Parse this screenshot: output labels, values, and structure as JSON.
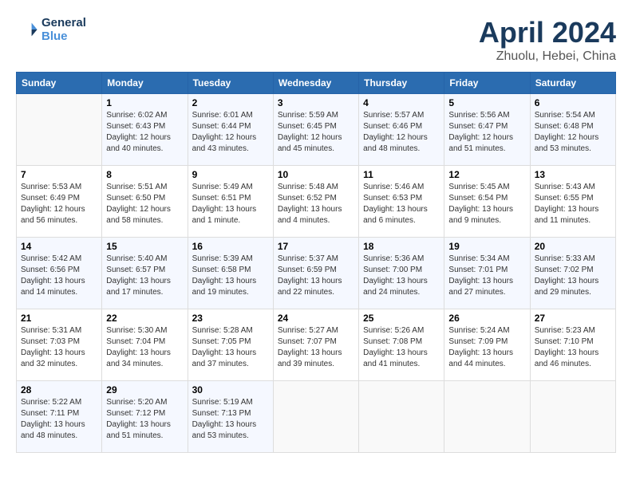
{
  "header": {
    "logo_line1": "General",
    "logo_line2": "Blue",
    "month_year": "April 2024",
    "location": "Zhuolu, Hebei, China"
  },
  "weekdays": [
    "Sunday",
    "Monday",
    "Tuesday",
    "Wednesday",
    "Thursday",
    "Friday",
    "Saturday"
  ],
  "weeks": [
    [
      {
        "day": "",
        "sunrise": "",
        "sunset": "",
        "daylight": ""
      },
      {
        "day": "1",
        "sunrise": "Sunrise: 6:02 AM",
        "sunset": "Sunset: 6:43 PM",
        "daylight": "Daylight: 12 hours and 40 minutes."
      },
      {
        "day": "2",
        "sunrise": "Sunrise: 6:01 AM",
        "sunset": "Sunset: 6:44 PM",
        "daylight": "Daylight: 12 hours and 43 minutes."
      },
      {
        "day": "3",
        "sunrise": "Sunrise: 5:59 AM",
        "sunset": "Sunset: 6:45 PM",
        "daylight": "Daylight: 12 hours and 45 minutes."
      },
      {
        "day": "4",
        "sunrise": "Sunrise: 5:57 AM",
        "sunset": "Sunset: 6:46 PM",
        "daylight": "Daylight: 12 hours and 48 minutes."
      },
      {
        "day": "5",
        "sunrise": "Sunrise: 5:56 AM",
        "sunset": "Sunset: 6:47 PM",
        "daylight": "Daylight: 12 hours and 51 minutes."
      },
      {
        "day": "6",
        "sunrise": "Sunrise: 5:54 AM",
        "sunset": "Sunset: 6:48 PM",
        "daylight": "Daylight: 12 hours and 53 minutes."
      }
    ],
    [
      {
        "day": "7",
        "sunrise": "Sunrise: 5:53 AM",
        "sunset": "Sunset: 6:49 PM",
        "daylight": "Daylight: 12 hours and 56 minutes."
      },
      {
        "day": "8",
        "sunrise": "Sunrise: 5:51 AM",
        "sunset": "Sunset: 6:50 PM",
        "daylight": "Daylight: 12 hours and 58 minutes."
      },
      {
        "day": "9",
        "sunrise": "Sunrise: 5:49 AM",
        "sunset": "Sunset: 6:51 PM",
        "daylight": "Daylight: 13 hours and 1 minute."
      },
      {
        "day": "10",
        "sunrise": "Sunrise: 5:48 AM",
        "sunset": "Sunset: 6:52 PM",
        "daylight": "Daylight: 13 hours and 4 minutes."
      },
      {
        "day": "11",
        "sunrise": "Sunrise: 5:46 AM",
        "sunset": "Sunset: 6:53 PM",
        "daylight": "Daylight: 13 hours and 6 minutes."
      },
      {
        "day": "12",
        "sunrise": "Sunrise: 5:45 AM",
        "sunset": "Sunset: 6:54 PM",
        "daylight": "Daylight: 13 hours and 9 minutes."
      },
      {
        "day": "13",
        "sunrise": "Sunrise: 5:43 AM",
        "sunset": "Sunset: 6:55 PM",
        "daylight": "Daylight: 13 hours and 11 minutes."
      }
    ],
    [
      {
        "day": "14",
        "sunrise": "Sunrise: 5:42 AM",
        "sunset": "Sunset: 6:56 PM",
        "daylight": "Daylight: 13 hours and 14 minutes."
      },
      {
        "day": "15",
        "sunrise": "Sunrise: 5:40 AM",
        "sunset": "Sunset: 6:57 PM",
        "daylight": "Daylight: 13 hours and 17 minutes."
      },
      {
        "day": "16",
        "sunrise": "Sunrise: 5:39 AM",
        "sunset": "Sunset: 6:58 PM",
        "daylight": "Daylight: 13 hours and 19 minutes."
      },
      {
        "day": "17",
        "sunrise": "Sunrise: 5:37 AM",
        "sunset": "Sunset: 6:59 PM",
        "daylight": "Daylight: 13 hours and 22 minutes."
      },
      {
        "day": "18",
        "sunrise": "Sunrise: 5:36 AM",
        "sunset": "Sunset: 7:00 PM",
        "daylight": "Daylight: 13 hours and 24 minutes."
      },
      {
        "day": "19",
        "sunrise": "Sunrise: 5:34 AM",
        "sunset": "Sunset: 7:01 PM",
        "daylight": "Daylight: 13 hours and 27 minutes."
      },
      {
        "day": "20",
        "sunrise": "Sunrise: 5:33 AM",
        "sunset": "Sunset: 7:02 PM",
        "daylight": "Daylight: 13 hours and 29 minutes."
      }
    ],
    [
      {
        "day": "21",
        "sunrise": "Sunrise: 5:31 AM",
        "sunset": "Sunset: 7:03 PM",
        "daylight": "Daylight: 13 hours and 32 minutes."
      },
      {
        "day": "22",
        "sunrise": "Sunrise: 5:30 AM",
        "sunset": "Sunset: 7:04 PM",
        "daylight": "Daylight: 13 hours and 34 minutes."
      },
      {
        "day": "23",
        "sunrise": "Sunrise: 5:28 AM",
        "sunset": "Sunset: 7:05 PM",
        "daylight": "Daylight: 13 hours and 37 minutes."
      },
      {
        "day": "24",
        "sunrise": "Sunrise: 5:27 AM",
        "sunset": "Sunset: 7:07 PM",
        "daylight": "Daylight: 13 hours and 39 minutes."
      },
      {
        "day": "25",
        "sunrise": "Sunrise: 5:26 AM",
        "sunset": "Sunset: 7:08 PM",
        "daylight": "Daylight: 13 hours and 41 minutes."
      },
      {
        "day": "26",
        "sunrise": "Sunrise: 5:24 AM",
        "sunset": "Sunset: 7:09 PM",
        "daylight": "Daylight: 13 hours and 44 minutes."
      },
      {
        "day": "27",
        "sunrise": "Sunrise: 5:23 AM",
        "sunset": "Sunset: 7:10 PM",
        "daylight": "Daylight: 13 hours and 46 minutes."
      }
    ],
    [
      {
        "day": "28",
        "sunrise": "Sunrise: 5:22 AM",
        "sunset": "Sunset: 7:11 PM",
        "daylight": "Daylight: 13 hours and 48 minutes."
      },
      {
        "day": "29",
        "sunrise": "Sunrise: 5:20 AM",
        "sunset": "Sunset: 7:12 PM",
        "daylight": "Daylight: 13 hours and 51 minutes."
      },
      {
        "day": "30",
        "sunrise": "Sunrise: 5:19 AM",
        "sunset": "Sunset: 7:13 PM",
        "daylight": "Daylight: 13 hours and 53 minutes."
      },
      {
        "day": "",
        "sunrise": "",
        "sunset": "",
        "daylight": ""
      },
      {
        "day": "",
        "sunrise": "",
        "sunset": "",
        "daylight": ""
      },
      {
        "day": "",
        "sunrise": "",
        "sunset": "",
        "daylight": ""
      },
      {
        "day": "",
        "sunrise": "",
        "sunset": "",
        "daylight": ""
      }
    ]
  ]
}
